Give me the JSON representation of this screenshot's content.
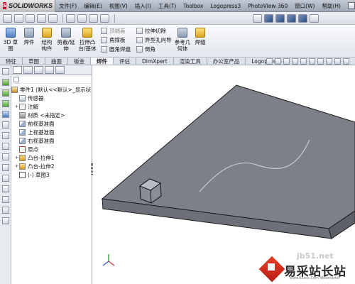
{
  "app": {
    "logo_text": "SOLIDWORKS",
    "logo_mark": "S"
  },
  "menubar": [
    "文件(F)",
    "编辑(E)",
    "视图(V)",
    "插入(I)",
    "工具(T)",
    "Toolbox",
    "Logopress3",
    "PhotoView 360",
    "窗口(W)",
    "帮助(H)"
  ],
  "ribbon": {
    "large_buttons": [
      {
        "label": "3D 草图",
        "icon": "3d-sketch-icon"
      },
      {
        "label": "焊件",
        "icon": "weldment-icon"
      },
      {
        "label": "结构构件",
        "icon": "structural-member-icon"
      },
      {
        "label": "剪裁/延伸",
        "icon": "trim-extend-icon"
      },
      {
        "label": "拉伸凸台/基体",
        "icon": "extruded-boss-icon"
      },
      {
        "label": "参考几何体",
        "icon": "reference-geometry-icon"
      },
      {
        "label": "焊缝",
        "icon": "weld-bead-icon"
      }
    ],
    "small_buttons_col1": [
      {
        "label": "顶端盖",
        "enabled": false
      },
      {
        "label": "角撑板",
        "enabled": true
      },
      {
        "label": "圆角焊缝",
        "enabled": true
      }
    ],
    "small_buttons_col2": [
      {
        "label": "拉伸切除",
        "enabled": true
      },
      {
        "label": "异型孔向导",
        "enabled": true
      },
      {
        "label": "倒角",
        "enabled": true
      }
    ]
  },
  "command_tabs": [
    "特征",
    "草图",
    "曲面",
    "钣金",
    "焊件",
    "评估",
    "DimXpert",
    "渲染工具",
    "办公室产品",
    "Logopress3"
  ],
  "active_tab": "焊件",
  "feature_tree": {
    "root": "零件1 (默认<<默认>_显示状",
    "nodes": [
      {
        "label": "传感器",
        "icon": "sensor-icon",
        "expander": ""
      },
      {
        "label": "注解",
        "icon": "annotations-icon",
        "expander": "+"
      },
      {
        "label": "材质 <未指定>",
        "icon": "material-icon",
        "expander": ""
      },
      {
        "label": "前视基准面",
        "icon": "plane-icon",
        "expander": ""
      },
      {
        "label": "上视基准面",
        "icon": "plane-icon",
        "expander": ""
      },
      {
        "label": "右视基准面",
        "icon": "plane-icon",
        "expander": ""
      },
      {
        "label": "原点",
        "icon": "origin-icon",
        "expander": ""
      },
      {
        "label": "凸台-拉伸1",
        "icon": "extrude-icon",
        "expander": "+"
      },
      {
        "label": "凸台-拉伸2",
        "icon": "extrude-icon",
        "expander": "+"
      },
      {
        "label": "(-) 草图3",
        "icon": "sketch-icon",
        "expander": ""
      }
    ]
  },
  "watermark": {
    "main": "易采站长站",
    "url": "jb51.net",
    "sub": "www.Easck.Com Webmaster"
  }
}
